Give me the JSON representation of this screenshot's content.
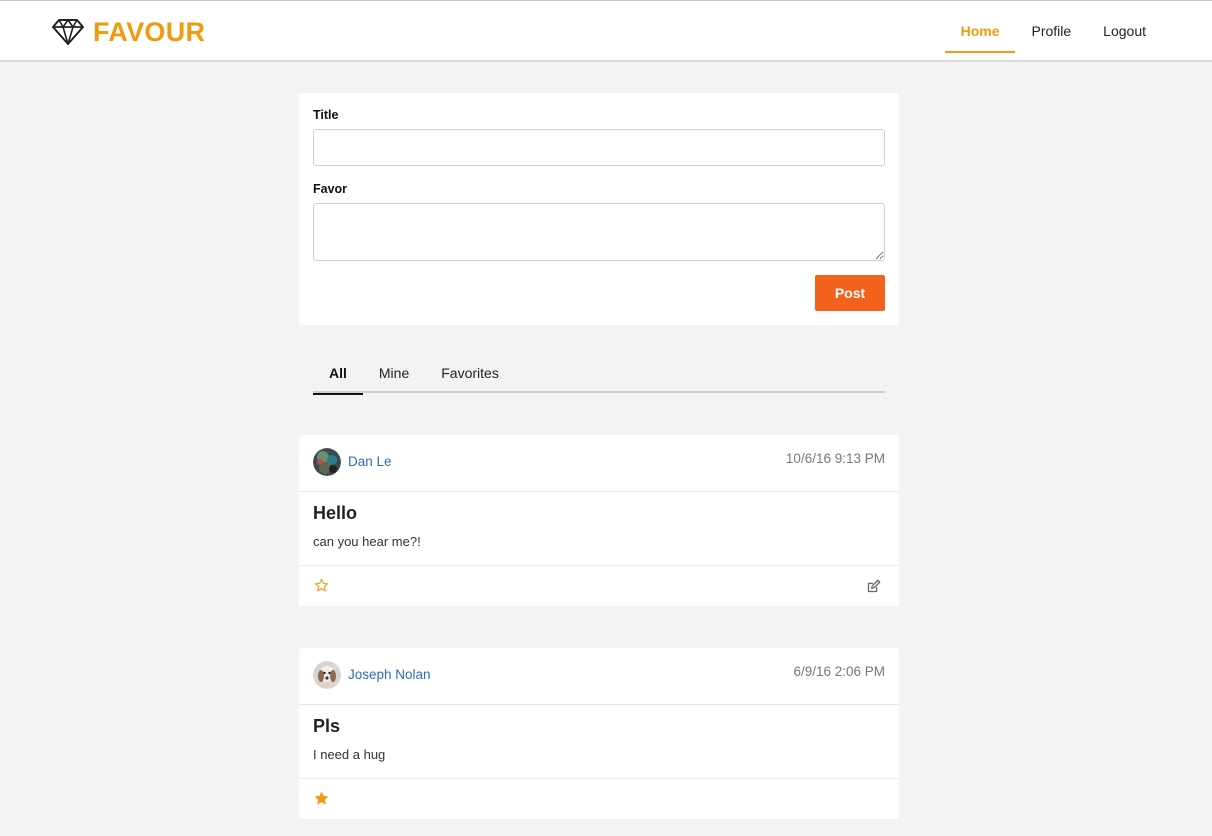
{
  "header": {
    "brand_name": "FAVOUR",
    "nav": [
      {
        "label": "Home",
        "active": true
      },
      {
        "label": "Profile",
        "active": false
      },
      {
        "label": "Logout",
        "active": false
      }
    ]
  },
  "composer": {
    "title_label": "Title",
    "title_value": "",
    "favor_label": "Favor",
    "favor_value": "",
    "post_label": "Post"
  },
  "tabs": [
    {
      "label": "All",
      "active": true
    },
    {
      "label": "Mine",
      "active": false
    },
    {
      "label": "Favorites",
      "active": false
    }
  ],
  "posts": [
    {
      "author": "Dan Le",
      "timestamp": "10/6/16 9:13 PM",
      "title": "Hello",
      "body": "can you hear me?!",
      "favorited": false,
      "editable": true,
      "avatar_icon": "user-avatar-photo"
    },
    {
      "author": "Joseph Nolan",
      "timestamp": "6/9/16 2:06 PM",
      "title": "Pls",
      "body": "I need a hug",
      "favorited": true,
      "editable": false,
      "avatar_icon": "user-avatar-photo"
    }
  ],
  "colors": {
    "brand": "#f29a0f",
    "post_button": "#f2621d",
    "author_link": "#2f6db5",
    "star": "#f29a0f"
  }
}
